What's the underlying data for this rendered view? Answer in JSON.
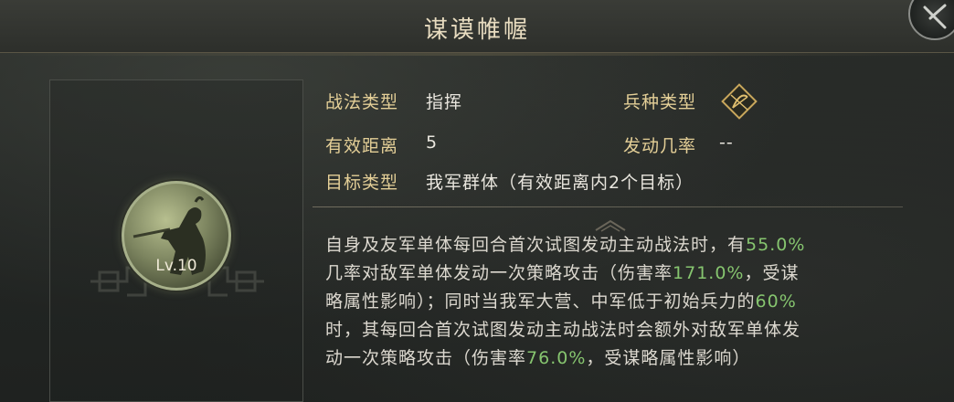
{
  "header": {
    "title": "谋谟帷幄"
  },
  "portrait": {
    "level": "Lv.10",
    "icon": "general-portrait"
  },
  "info": {
    "tactic_type_label": "战法类型",
    "tactic_type_value": "指挥",
    "troop_type_label": "兵种类型",
    "troop_type_icon": "archer-bow-icon",
    "range_label": "有效距离",
    "range_value": "5",
    "trigger_rate_label": "发动几率",
    "trigger_rate_value": "--",
    "target_label": "目标类型",
    "target_value": "我军群体（有效距离内2个目标）"
  },
  "description": {
    "line1_pre": "自身及友军单体每回合首次试图发动主动战法时，有",
    "line1_hl": "55.0%",
    "line2_pre": "几率对敌军单体发动一次策略攻击（伤害率",
    "line2_hl": "171.0%",
    "line2_post": "，受谋",
    "line3_pre": "略属性影响）；同时当我军大营、中军低于初始兵力的",
    "line3_hl": "60%",
    "line4": "时，其每回合首次试图发动主动战法时会额外对敌军单体发",
    "line5_pre": "动一次策略攻击（伤害率",
    "line5_hl": "76.0%",
    "line5_post": "，受谋略属性影响）"
  },
  "colors": {
    "label_gold": "#e4cf97",
    "highlight_green": "#86c56f",
    "title": "#e8dcc0"
  }
}
